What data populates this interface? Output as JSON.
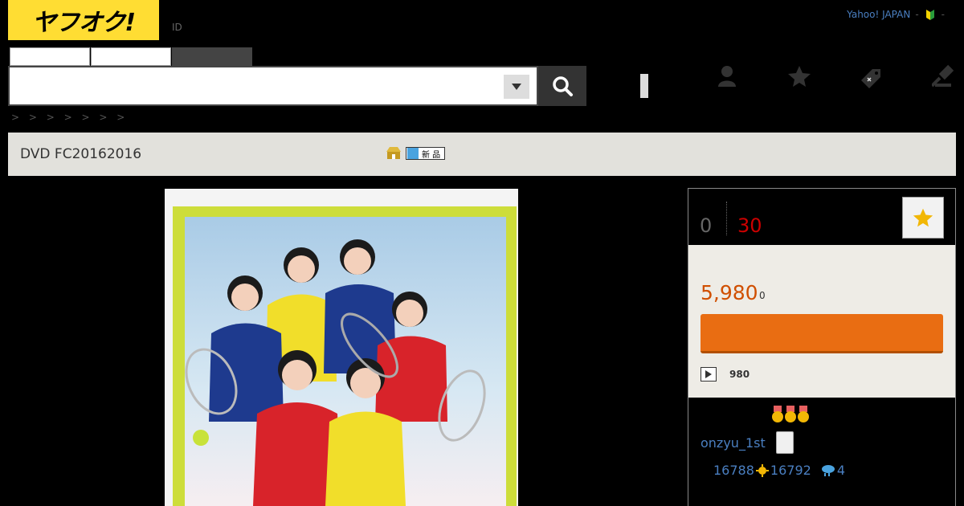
{
  "header": {
    "logo_text": "ヤフオク!",
    "id_label": "ID",
    "yahoo_japan": "Yahoo! JAPAN",
    "sep1": "-",
    "sep2": "-",
    "search_placeholder": ""
  },
  "breadcrumb": "> >    > > > >    >",
  "item": {
    "title": "DVD FC20162016",
    "badge_text": "新 品"
  },
  "panel": {
    "bids": "0",
    "time_left": "30",
    "price": "5,980",
    "price_suffix": "0",
    "shipping_value": "980"
  },
  "seller": {
    "name": "onzyu_1st",
    "rating_total": "16788",
    "rating_good": "16792",
    "rating_bad": "4"
  },
  "colors": {
    "logo_yellow": "#ffdd33",
    "buy_orange": "#e96d12",
    "price_orange": "#d04f00",
    "time_red": "#cc0000",
    "link_blue": "#4a7fc1"
  }
}
